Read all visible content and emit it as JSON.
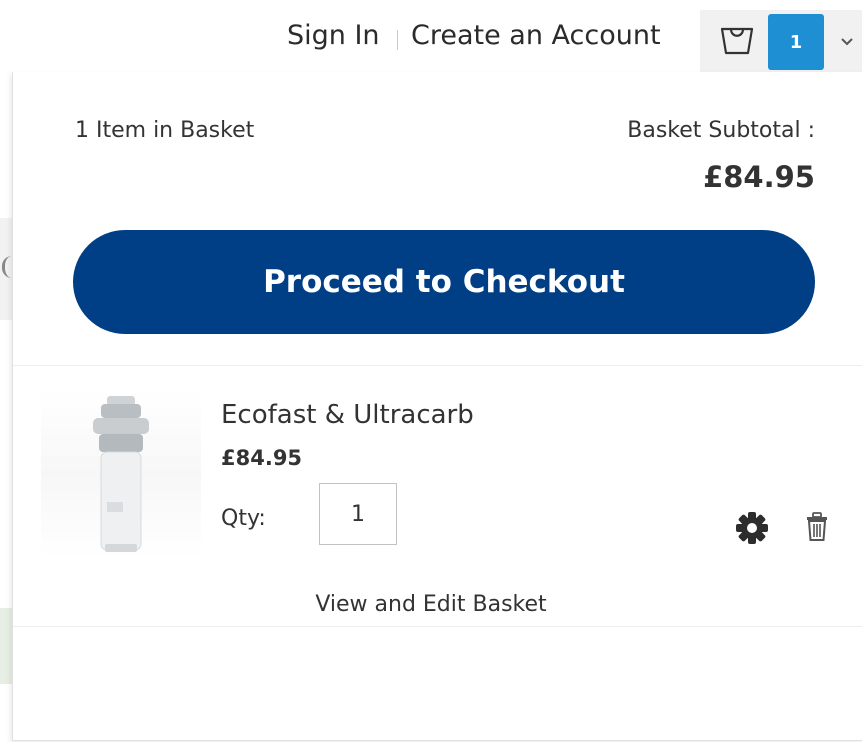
{
  "header": {
    "sign_in": "Sign In",
    "create_account": "Create an Account",
    "cart_count": "1"
  },
  "minicart": {
    "items_count": "1 Item in Basket",
    "subtotal_label": "Basket Subtotal :",
    "subtotal_amount": "£84.95",
    "checkout_label": "Proceed to Checkout",
    "view_edit_label": "View and Edit Basket",
    "item": {
      "name": "Ecofast & Ultracarb",
      "price": "£84.95",
      "qty_label": "Qty:",
      "qty_value": "1",
      "edit_icon": "gear-icon",
      "remove_icon": "trash-icon"
    }
  },
  "colors": {
    "checkout_bg": "#003f86",
    "badge_bg": "#1d8fd2",
    "trigger_bg": "#f1f1f1"
  }
}
